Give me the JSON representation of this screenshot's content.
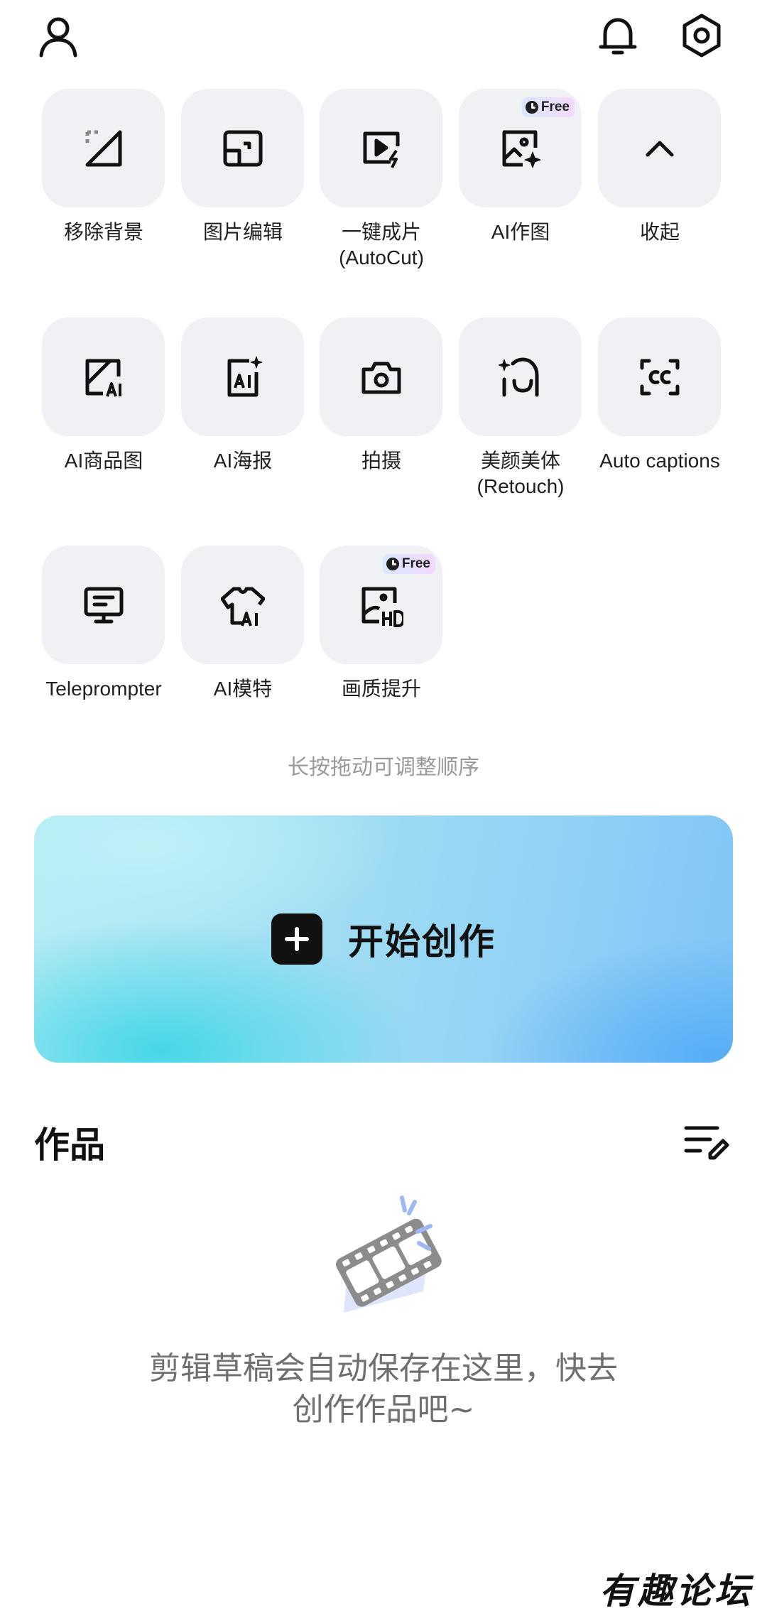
{
  "header": {
    "profile_icon": "user-outline-icon",
    "notification_icon": "bell-icon",
    "settings_icon": "hexagon-settings-icon"
  },
  "tools": [
    {
      "id": "remove-bg",
      "label": "移除背景",
      "icon": "remove-background-icon",
      "free": false
    },
    {
      "id": "photo-edit",
      "label": "图片编辑",
      "icon": "image-edit-icon",
      "free": false
    },
    {
      "id": "autocut",
      "label": "一键成片\n(AutoCut)",
      "icon": "video-lightning-icon",
      "free": false
    },
    {
      "id": "ai-image",
      "label": "AI作图",
      "icon": "ai-image-sparkle-icon",
      "free": true
    },
    {
      "id": "collapse",
      "label": "收起",
      "icon": "chevron-up-icon",
      "free": false
    },
    {
      "id": "ai-product",
      "label": "AI商品图",
      "icon": "ai-product-icon",
      "free": false
    },
    {
      "id": "ai-poster",
      "label": "AI海报",
      "icon": "ai-poster-icon",
      "free": false
    },
    {
      "id": "shoot",
      "label": "拍摄",
      "icon": "camera-icon",
      "free": false
    },
    {
      "id": "retouch",
      "label": "美颜美体\n(Retouch)",
      "icon": "retouch-face-icon",
      "free": false
    },
    {
      "id": "auto-captions",
      "label": "Auto captions",
      "icon": "captions-cc-icon",
      "free": false
    },
    {
      "id": "teleprompter",
      "label": "Teleprompter",
      "icon": "teleprompter-monitor-icon",
      "free": false
    },
    {
      "id": "ai-model",
      "label": "AI模特",
      "icon": "ai-shirt-icon",
      "free": false
    },
    {
      "id": "enhance",
      "label": "画质提升",
      "icon": "hd-image-icon",
      "free": true
    }
  ],
  "free_badge_label": "Free",
  "hint": "长按拖动可调整顺序",
  "create_button": {
    "label": "开始创作",
    "icon": "plus-square-icon"
  },
  "works": {
    "title": "作品",
    "manage_icon": "list-edit-icon",
    "empty_icon": "film-strip-icon",
    "empty_text": "剪辑草稿会自动保存在这里，快去\n创作作品吧~"
  },
  "watermark": "有趣论坛",
  "colors": {
    "tile_bg": "#eff1f5",
    "text_primary": "#1f1f1f",
    "hint_text": "#9a9a9a",
    "create_gradient_start": "#b6ecf4",
    "create_gradient_end": "#54acf6"
  }
}
